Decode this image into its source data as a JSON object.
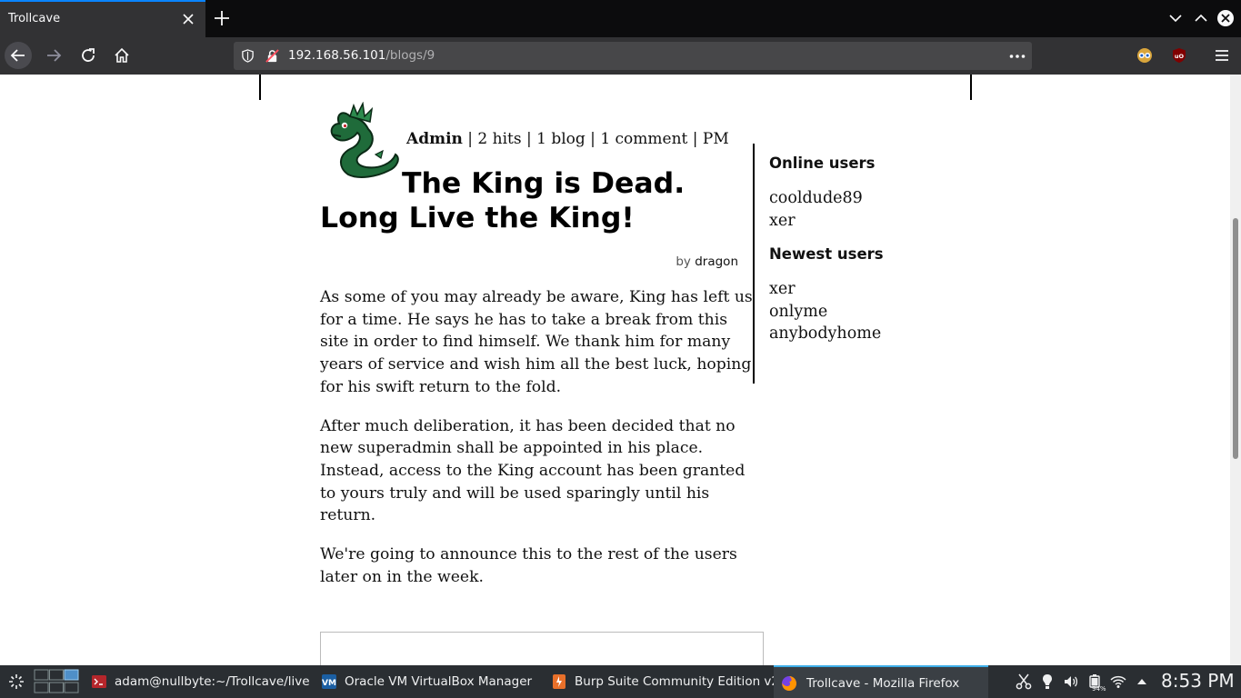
{
  "browser": {
    "tab_title": "Trollcave",
    "url_host": "192.168.56.101",
    "url_path": "/blogs/9"
  },
  "post": {
    "author": "Admin",
    "stats": " | 2 hits | 1 blog | 1 comment | PM",
    "title": "The King is Dead. Long Live the King!",
    "by_label": "by",
    "by_name": "dragon",
    "paragraphs": [
      "As some of you may already be aware, King has left us for a time. He says he has to take a break from this site in order to find himself. We thank him for many years of service and wish him all the best luck, hoping for his swift return to the fold.",
      "After much deliberation, it has been decided that no new superadmin shall be appointed in his place. Instead, access to the King account has been granted to yours truly and will be used sparingly until his return.",
      "We're going to announce this to the rest of the users later on in the week."
    ]
  },
  "sidebar": {
    "online_heading": "Online users",
    "online_users": [
      "cooldude89",
      "xer"
    ],
    "newest_heading": "Newest users",
    "newest_users": [
      "xer",
      "onlyme",
      "anybodyhome"
    ]
  },
  "taskbar": {
    "items": [
      "adam@nullbyte:~/Trollcave/live",
      "Oracle VM VirtualBox Manager",
      "Burp Suite Community Edition v2...",
      "Trollcave - Mozilla Firefox"
    ],
    "battery": "94%",
    "clock": "8:53 PM"
  },
  "colors": {
    "tab_accent": "#0a84ff",
    "taskbar_bg": "#2a2e32",
    "dragon_green": "#1f6b3a"
  },
  "icons": [
    "close-icon",
    "plus-icon",
    "chevron-down-icon",
    "chevron-up-icon",
    "back-arrow-icon",
    "forward-arrow-icon",
    "reload-icon",
    "home-icon",
    "shield-icon",
    "insecure-lock-icon",
    "more-icon",
    "hamburger-menu-icon",
    "terminal-icon",
    "virtualbox-icon",
    "burp-icon",
    "firefox-icon",
    "dragon-avatar"
  ]
}
